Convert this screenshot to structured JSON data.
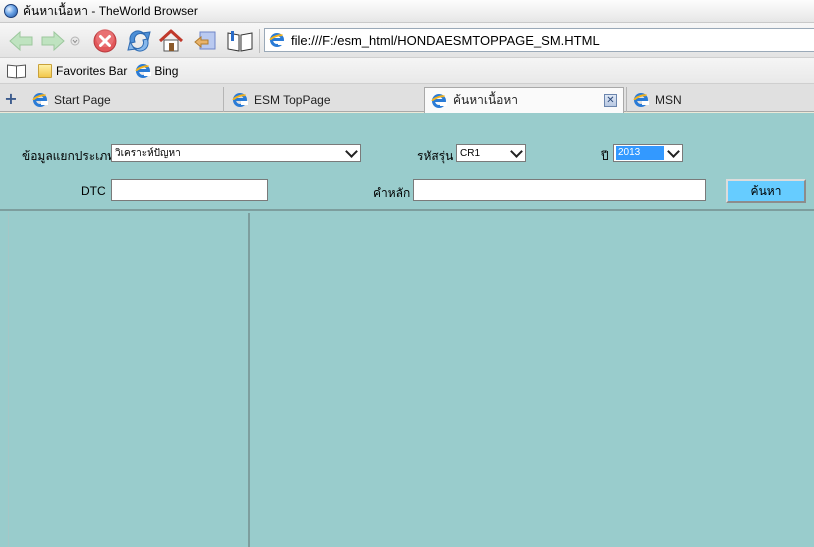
{
  "window": {
    "title": "ค้นหาเนื้อหา - TheWorld Browser"
  },
  "toolbar": {
    "back_icon": "back-arrow-icon",
    "forward_icon": "forward-arrow-icon",
    "stop_icon": "stop-icon",
    "refresh_icon": "refresh-icon",
    "home_icon": "home-icon",
    "history_icon": "history-icon",
    "favorites_icon": "favorites-book-icon",
    "address_url": "file:///F:/esm_html/HONDAESMTOPPAGE_SM.HTML"
  },
  "favorites_bar": {
    "items": [
      {
        "label": "Favorites Bar",
        "icon": "folder-icon"
      },
      {
        "label": "Bing",
        "icon": "ie-icon"
      }
    ]
  },
  "tabs": [
    {
      "label": "Start Page",
      "active": false
    },
    {
      "label": "ESM TopPage",
      "active": false
    },
    {
      "label": "ค้นหาเนื้อหา",
      "active": true
    },
    {
      "label": "MSN",
      "active": false
    }
  ],
  "search_form": {
    "category_label": "ข้อมูลแยกประเภท",
    "category_value": "วิเคราะห์ปัญหา",
    "model_label": "รหัสรุ่น",
    "model_value": "CR1",
    "year_label": "ปี",
    "year_value": "2013",
    "dtc_label": "DTC",
    "dtc_value": "",
    "keyword_label": "คำหลัก",
    "keyword_value": "",
    "search_button": "ค้นหา"
  },
  "colors": {
    "content_bg": "#99cccc",
    "search_button_bg": "#66ccff",
    "selection_highlight": "#3399ff"
  }
}
